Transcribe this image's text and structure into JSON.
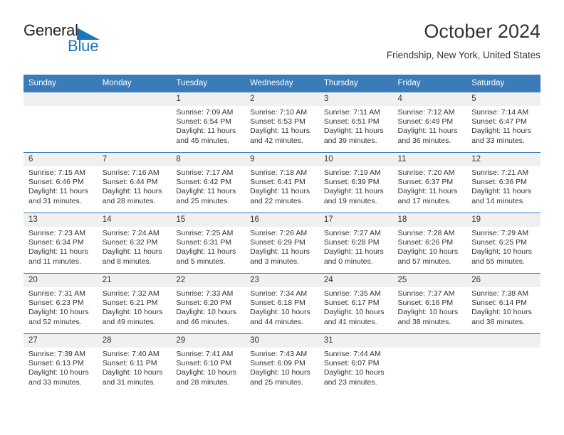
{
  "brand": {
    "name_top": "General",
    "name_bottom": "Blue",
    "triangle_color": "#1b75bb",
    "text_color": "#231f20"
  },
  "header": {
    "title": "October 2024",
    "subtitle": "Friendship, New York, United States"
  },
  "theme": {
    "header_blue": "#3a7cb9",
    "daynum_band": "#f0f0f0",
    "text": "#333333"
  },
  "weekday_headers": [
    "Sunday",
    "Monday",
    "Tuesday",
    "Wednesday",
    "Thursday",
    "Friday",
    "Saturday"
  ],
  "labels": {
    "sunrise_prefix": "Sunrise:",
    "sunset_prefix": "Sunset:",
    "daylight_prefix": "Daylight:"
  },
  "weeks": [
    [
      {
        "empty": true
      },
      {
        "empty": true
      },
      {
        "day": "1",
        "l1": "Sunrise: 7:09 AM",
        "l2": "Sunset: 6:54 PM",
        "l3": "Daylight: 11 hours and 45 minutes."
      },
      {
        "day": "2",
        "l1": "Sunrise: 7:10 AM",
        "l2": "Sunset: 6:53 PM",
        "l3": "Daylight: 11 hours and 42 minutes."
      },
      {
        "day": "3",
        "l1": "Sunrise: 7:11 AM",
        "l2": "Sunset: 6:51 PM",
        "l3": "Daylight: 11 hours and 39 minutes."
      },
      {
        "day": "4",
        "l1": "Sunrise: 7:12 AM",
        "l2": "Sunset: 6:49 PM",
        "l3": "Daylight: 11 hours and 36 minutes."
      },
      {
        "day": "5",
        "l1": "Sunrise: 7:14 AM",
        "l2": "Sunset: 6:47 PM",
        "l3": "Daylight: 11 hours and 33 minutes."
      }
    ],
    [
      {
        "day": "6",
        "l1": "Sunrise: 7:15 AM",
        "l2": "Sunset: 6:46 PM",
        "l3": "Daylight: 11 hours and 31 minutes."
      },
      {
        "day": "7",
        "l1": "Sunrise: 7:16 AM",
        "l2": "Sunset: 6:44 PM",
        "l3": "Daylight: 11 hours and 28 minutes."
      },
      {
        "day": "8",
        "l1": "Sunrise: 7:17 AM",
        "l2": "Sunset: 6:42 PM",
        "l3": "Daylight: 11 hours and 25 minutes."
      },
      {
        "day": "9",
        "l1": "Sunrise: 7:18 AM",
        "l2": "Sunset: 6:41 PM",
        "l3": "Daylight: 11 hours and 22 minutes."
      },
      {
        "day": "10",
        "l1": "Sunrise: 7:19 AM",
        "l2": "Sunset: 6:39 PM",
        "l3": "Daylight: 11 hours and 19 minutes."
      },
      {
        "day": "11",
        "l1": "Sunrise: 7:20 AM",
        "l2": "Sunset: 6:37 PM",
        "l3": "Daylight: 11 hours and 17 minutes."
      },
      {
        "day": "12",
        "l1": "Sunrise: 7:21 AM",
        "l2": "Sunset: 6:36 PM",
        "l3": "Daylight: 11 hours and 14 minutes."
      }
    ],
    [
      {
        "day": "13",
        "l1": "Sunrise: 7:23 AM",
        "l2": "Sunset: 6:34 PM",
        "l3": "Daylight: 11 hours and 11 minutes."
      },
      {
        "day": "14",
        "l1": "Sunrise: 7:24 AM",
        "l2": "Sunset: 6:32 PM",
        "l3": "Daylight: 11 hours and 8 minutes."
      },
      {
        "day": "15",
        "l1": "Sunrise: 7:25 AM",
        "l2": "Sunset: 6:31 PM",
        "l3": "Daylight: 11 hours and 5 minutes."
      },
      {
        "day": "16",
        "l1": "Sunrise: 7:26 AM",
        "l2": "Sunset: 6:29 PM",
        "l3": "Daylight: 11 hours and 3 minutes."
      },
      {
        "day": "17",
        "l1": "Sunrise: 7:27 AM",
        "l2": "Sunset: 6:28 PM",
        "l3": "Daylight: 11 hours and 0 minutes."
      },
      {
        "day": "18",
        "l1": "Sunrise: 7:28 AM",
        "l2": "Sunset: 6:26 PM",
        "l3": "Daylight: 10 hours and 57 minutes."
      },
      {
        "day": "19",
        "l1": "Sunrise: 7:29 AM",
        "l2": "Sunset: 6:25 PM",
        "l3": "Daylight: 10 hours and 55 minutes."
      }
    ],
    [
      {
        "day": "20",
        "l1": "Sunrise: 7:31 AM",
        "l2": "Sunset: 6:23 PM",
        "l3": "Daylight: 10 hours and 52 minutes."
      },
      {
        "day": "21",
        "l1": "Sunrise: 7:32 AM",
        "l2": "Sunset: 6:21 PM",
        "l3": "Daylight: 10 hours and 49 minutes."
      },
      {
        "day": "22",
        "l1": "Sunrise: 7:33 AM",
        "l2": "Sunset: 6:20 PM",
        "l3": "Daylight: 10 hours and 46 minutes."
      },
      {
        "day": "23",
        "l1": "Sunrise: 7:34 AM",
        "l2": "Sunset: 6:18 PM",
        "l3": "Daylight: 10 hours and 44 minutes."
      },
      {
        "day": "24",
        "l1": "Sunrise: 7:35 AM",
        "l2": "Sunset: 6:17 PM",
        "l3": "Daylight: 10 hours and 41 minutes."
      },
      {
        "day": "25",
        "l1": "Sunrise: 7:37 AM",
        "l2": "Sunset: 6:16 PM",
        "l3": "Daylight: 10 hours and 38 minutes."
      },
      {
        "day": "26",
        "l1": "Sunrise: 7:38 AM",
        "l2": "Sunset: 6:14 PM",
        "l3": "Daylight: 10 hours and 36 minutes."
      }
    ],
    [
      {
        "day": "27",
        "l1": "Sunrise: 7:39 AM",
        "l2": "Sunset: 6:13 PM",
        "l3": "Daylight: 10 hours and 33 minutes."
      },
      {
        "day": "28",
        "l1": "Sunrise: 7:40 AM",
        "l2": "Sunset: 6:11 PM",
        "l3": "Daylight: 10 hours and 31 minutes."
      },
      {
        "day": "29",
        "l1": "Sunrise: 7:41 AM",
        "l2": "Sunset: 6:10 PM",
        "l3": "Daylight: 10 hours and 28 minutes."
      },
      {
        "day": "30",
        "l1": "Sunrise: 7:43 AM",
        "l2": "Sunset: 6:09 PM",
        "l3": "Daylight: 10 hours and 25 minutes."
      },
      {
        "day": "31",
        "l1": "Sunrise: 7:44 AM",
        "l2": "Sunset: 6:07 PM",
        "l3": "Daylight: 10 hours and 23 minutes."
      },
      {
        "empty": true
      },
      {
        "empty": true
      }
    ]
  ]
}
